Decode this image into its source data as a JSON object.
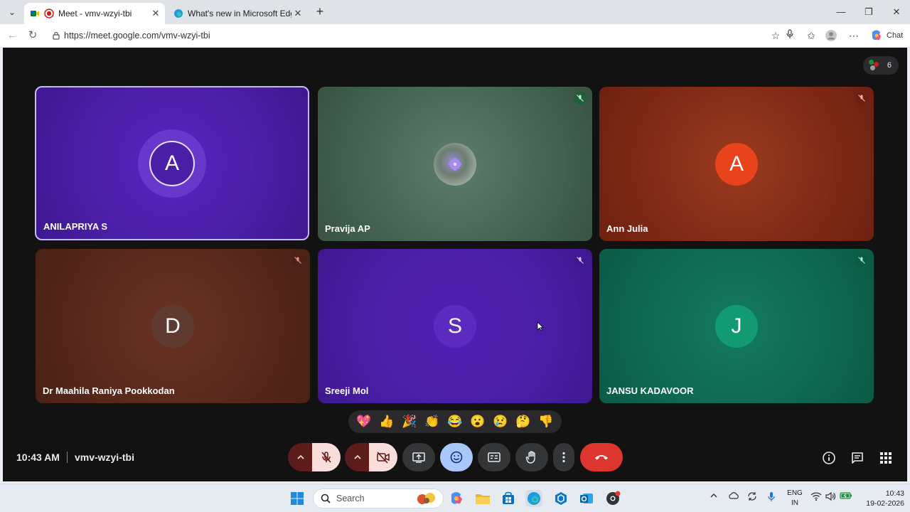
{
  "browser": {
    "tabs": [
      {
        "title": "Meet - vmv-wzyi-tbi",
        "active": true
      },
      {
        "title": "What's new in Microsoft Edge",
        "active": false
      }
    ],
    "url": "https://meet.google.com/vmv-wzyi-tbi",
    "chat_label": "Chat"
  },
  "meet": {
    "participant_count": "6",
    "tiles": [
      {
        "name": "ANILAPRIYA S",
        "initial": "A",
        "bg": "#4a1fa8",
        "speaking": true,
        "muted": false
      },
      {
        "name": "Pravija AP",
        "initial": "",
        "bg": "#3d5c4a",
        "speaking": false,
        "muted": true
      },
      {
        "name": "Ann Julia",
        "initial": "A",
        "bg": "#8a2a18",
        "speaking": false,
        "muted": true
      },
      {
        "name": "Dr Maahila Raniya Pookkodan",
        "initial": "D",
        "bg": "#5a2a1e",
        "speaking": false,
        "muted": true
      },
      {
        "name": "Sreeji Mol",
        "initial": "S",
        "bg": "#4a1fa8",
        "speaking": false,
        "muted": true
      },
      {
        "name": "JANSU KADAVOOR",
        "initial": "J",
        "bg": "#0f5f4a",
        "speaking": false,
        "muted": true
      }
    ],
    "reactions": [
      "💖",
      "👍",
      "🎉",
      "👏",
      "😂",
      "😮",
      "😢",
      "🤔",
      "👎"
    ],
    "time": "10:43 AM",
    "meeting_code": "vmv-wzyi-tbi"
  },
  "taskbar": {
    "search_placeholder": "Search",
    "lang_line1": "ENG",
    "lang_line2": "IN",
    "clock_time": "10:43",
    "clock_date": "19-02-2026"
  }
}
